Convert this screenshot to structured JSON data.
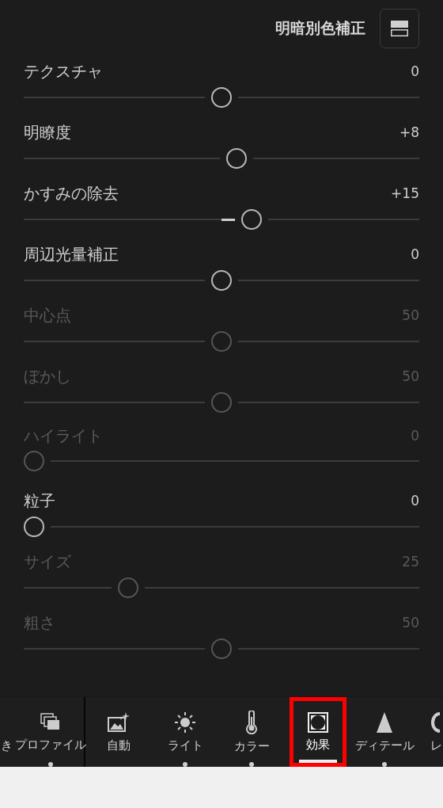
{
  "header": {
    "title": "明暗別色補正"
  },
  "sections": [
    {
      "sliders": [
        {
          "label": "テクスチャ",
          "value": "0",
          "kind": "bipolar",
          "disabled": false,
          "level": 0.5
        },
        {
          "label": "明瞭度",
          "value": "+8",
          "kind": "bipolar",
          "disabled": false,
          "level": 0.54
        },
        {
          "label": "かすみの除去",
          "value": "+15",
          "kind": "bipolar",
          "disabled": false,
          "level": 0.58
        },
        {
          "label": "周辺光量補正",
          "value": "0",
          "kind": "bipolar",
          "disabled": false,
          "level": 0.5
        },
        {
          "label": "中心点",
          "value": "50",
          "kind": "unipolar",
          "disabled": true,
          "level": 0.5
        },
        {
          "label": "ぼかし",
          "value": "50",
          "kind": "unipolar",
          "disabled": true,
          "level": 0.5
        },
        {
          "label": "ハイライト",
          "value": "0",
          "kind": "unipolar",
          "disabled": true,
          "level": 0
        }
      ]
    },
    {
      "sliders": [
        {
          "label": "粒子",
          "value": "0",
          "kind": "unipolar",
          "disabled": false,
          "level": 0
        },
        {
          "label": "サイズ",
          "value": "25",
          "kind": "unipolar",
          "disabled": true,
          "level": 0.25
        },
        {
          "label": "粗さ",
          "value": "50",
          "kind": "unipolar",
          "disabled": true,
          "level": 0.5
        }
      ]
    }
  ],
  "toolbar": [
    {
      "label": "き",
      "kind": "partial_left",
      "dot": false,
      "selected": false,
      "highlighted": false
    },
    {
      "label": "プロファイル",
      "kind": "profile",
      "dot": true,
      "selected": false,
      "highlighted": false
    },
    {
      "label": "自動",
      "kind": "auto",
      "dot": false,
      "selected": false,
      "highlighted": false
    },
    {
      "label": "ライト",
      "kind": "light",
      "dot": true,
      "selected": false,
      "highlighted": false
    },
    {
      "label": "カラー",
      "kind": "color",
      "dot": true,
      "selected": false,
      "highlighted": false
    },
    {
      "label": "効果",
      "kind": "effects",
      "dot": false,
      "selected": true,
      "highlighted": true
    },
    {
      "label": "ディテール",
      "kind": "detail",
      "dot": true,
      "selected": false,
      "highlighted": false
    },
    {
      "label": "レ",
      "kind": "partial_right",
      "dot": false,
      "selected": false,
      "highlighted": false
    }
  ]
}
